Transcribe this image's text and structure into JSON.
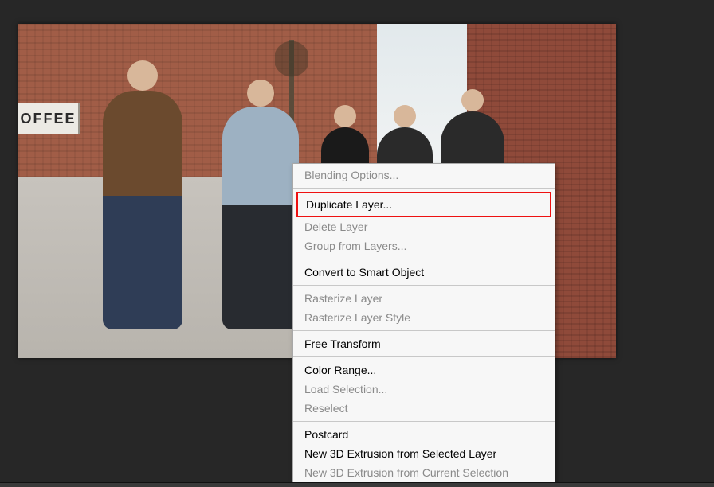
{
  "canvas": {
    "sign_text": "OFFEE"
  },
  "menu": {
    "blending_options": "Blending Options...",
    "duplicate_layer": "Duplicate Layer...",
    "delete_layer": "Delete Layer",
    "group_from_layers": "Group from Layers...",
    "convert_smart": "Convert to Smart Object",
    "rasterize_layer": "Rasterize Layer",
    "rasterize_style": "Rasterize Layer Style",
    "free_transform": "Free Transform",
    "color_range": "Color Range...",
    "load_selection": "Load Selection...",
    "reselect": "Reselect",
    "postcard": "Postcard",
    "new_3d_selected": "New 3D Extrusion from Selected Layer",
    "new_3d_current": "New 3D Extrusion from Current Selection"
  }
}
